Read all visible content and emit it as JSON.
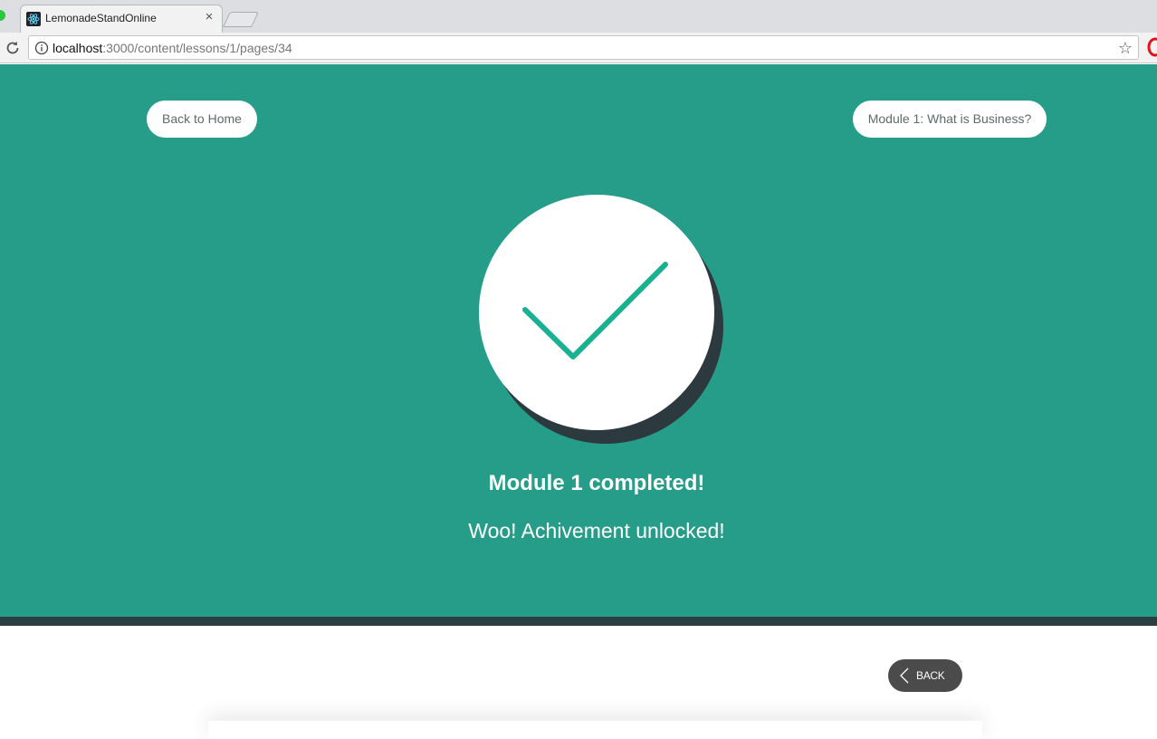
{
  "browser": {
    "tab_title": "LemonadeStandOnline",
    "tab_close": "×",
    "url_host": "localhost",
    "url_path": ":3000/content/lessons/1/pages/34",
    "star": "☆"
  },
  "nav": {
    "home_label": "Back to Home",
    "module_label": "Module 1: What is Business?"
  },
  "completion": {
    "title": "Module 1 completed!",
    "subtitle": "Woo! Achivement unlocked!"
  },
  "footer": {
    "back_label": "BACK"
  },
  "colors": {
    "hero_bg": "#269d88",
    "check": "#1ab192",
    "divider": "#2b3e44",
    "back_button": "#4b4b4b"
  },
  "icons": [
    "react-favicon-icon",
    "close-icon",
    "reload-icon",
    "info-icon",
    "star-icon",
    "check-icon",
    "chevron-left-icon"
  ]
}
